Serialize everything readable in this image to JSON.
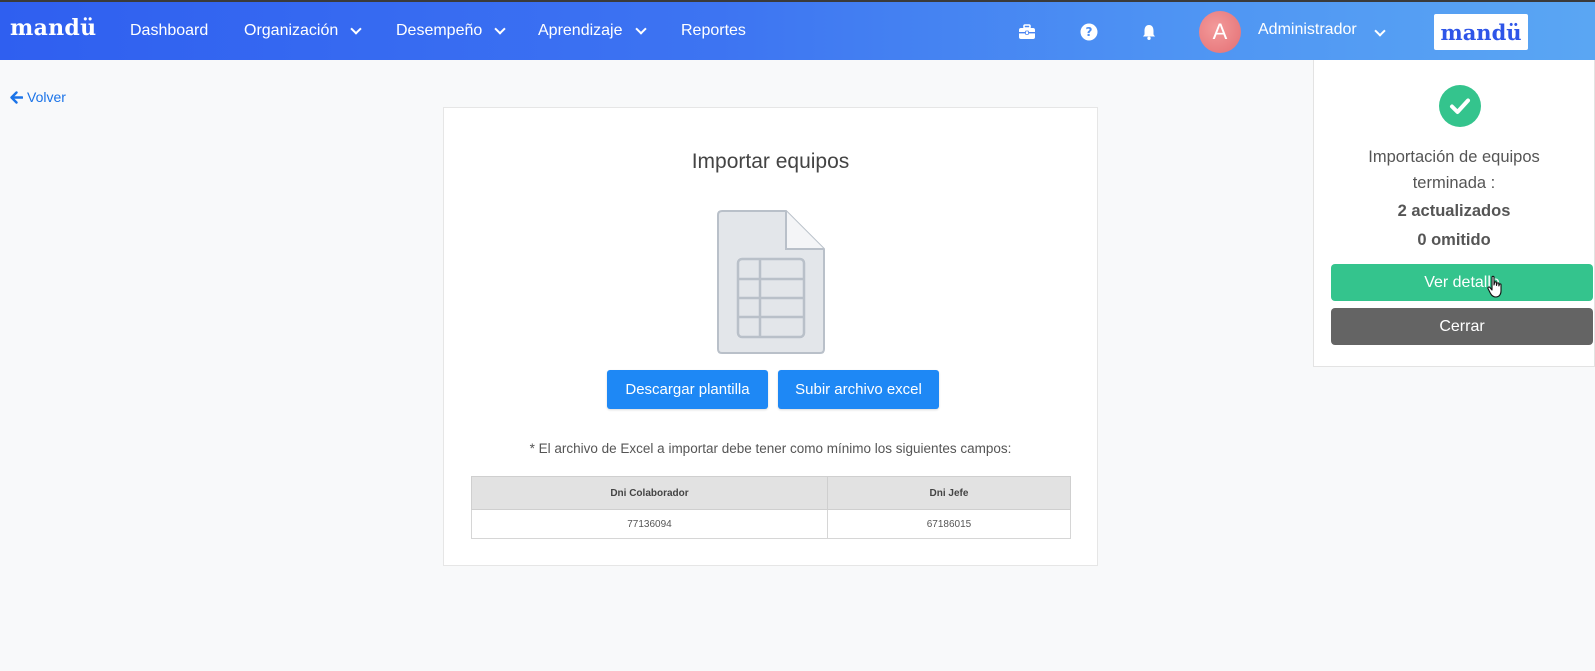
{
  "brand": "mandü",
  "nav": {
    "items": [
      {
        "label": "Dashboard"
      },
      {
        "label": "Organización"
      },
      {
        "label": "Desempeño"
      },
      {
        "label": "Aprendizaje"
      },
      {
        "label": "Reportes"
      }
    ],
    "user": {
      "initial": "A",
      "name": "Administrador"
    },
    "logo_text": "mandü",
    "icons": [
      "briefcase-icon",
      "help-icon",
      "bell-icon",
      "chevron-down-icon"
    ]
  },
  "back_label": "Volver",
  "card": {
    "title": "Importar equipos",
    "download_label": "Descargar plantilla",
    "upload_label": "Subir archivo excel",
    "note": "* El archivo de Excel a importar debe tener como mínimo los siguientes campos:",
    "table": {
      "headers": [
        "Dni Colaborador",
        "Dni Jefe"
      ],
      "rows": [
        [
          "77136094",
          "67186015"
        ]
      ]
    }
  },
  "notification": {
    "message_line1": "Importación de equipos",
    "message_line2": "terminada :",
    "updated": "2 actualizados",
    "skipped": "0 omitido",
    "detail_label": "Ver detalle",
    "close_label": "Cerrar"
  },
  "colors": {
    "nav_start": "#2f5ff0",
    "nav_end": "#5aa6f3",
    "primary": "#1e88f5",
    "success": "#34c48d",
    "close_btn": "#646464"
  }
}
